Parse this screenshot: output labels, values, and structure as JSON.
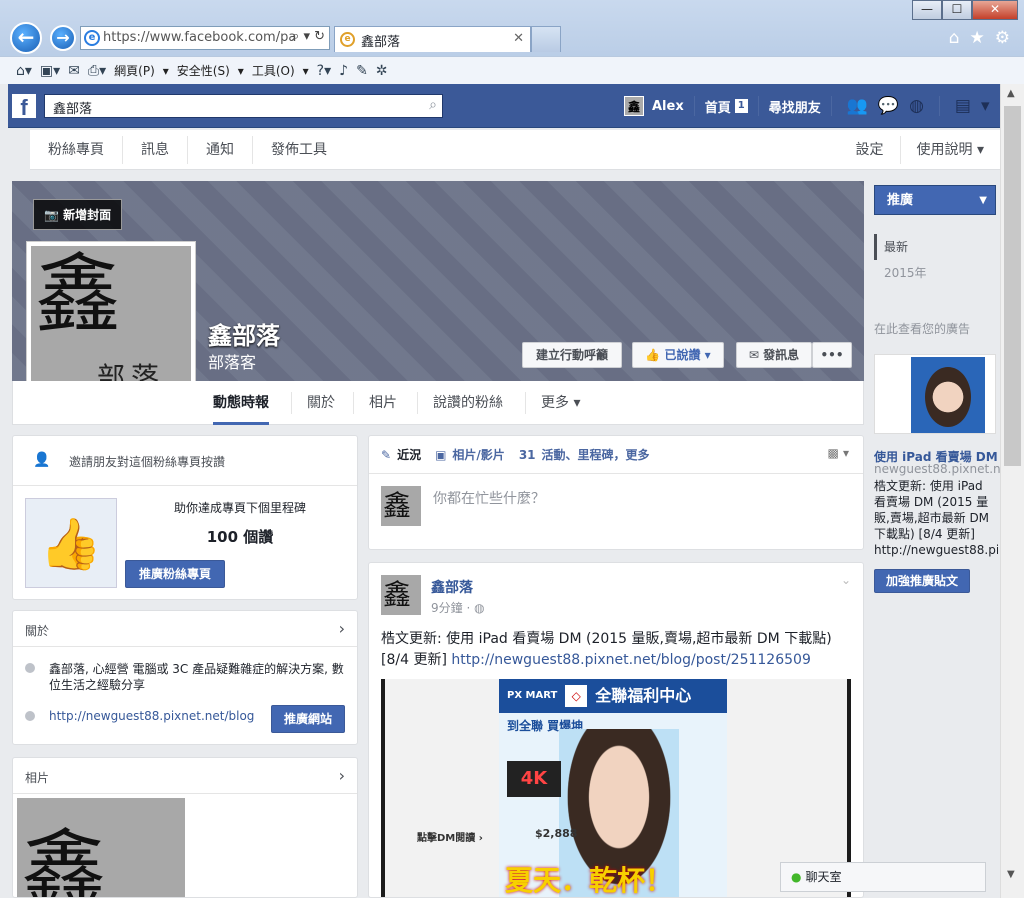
{
  "browser": {
    "address": "https://www.facebook.com/pa",
    "tab_title": "鑫部落",
    "menu_page": "網頁(P)",
    "menu_safety": "安全性(S)",
    "menu_tools": "工具(O)"
  },
  "fb": {
    "search_value": "鑫部落",
    "user": "Alex",
    "home": "首頁",
    "home_count": "1",
    "find_friends": "尋找朋友"
  },
  "pagenav": {
    "items": [
      "粉絲專頁",
      "訊息",
      "通知",
      "發佈工具"
    ],
    "settings": "設定",
    "help": "使用說明"
  },
  "cover": {
    "add_cover": "新增封面",
    "page_name": "鑫部落",
    "category": "部落客",
    "cta": "建立行動呼籲",
    "liked": "已說讚",
    "message": "發訊息",
    "more": "•••"
  },
  "tabs": [
    "動態時報",
    "關於",
    "相片",
    "說讚的粉絲",
    "更多"
  ],
  "invite": {
    "text": "邀請朋友對這個粉絲專頁按讚",
    "goal_line": "助你達成專頁下個里程碑",
    "goal_value": "100 個讚",
    "button": "推廣粉絲專頁"
  },
  "about": {
    "title": "關於",
    "description": "鑫部落, 心經營 電腦或 3C 產品疑難雜症的解決方案, 數位生活之經驗分享",
    "url": "http://newguest88.pixnet.net/blog",
    "button": "推廣網站"
  },
  "photos": {
    "title": "相片"
  },
  "composer": {
    "tab_status": "近況",
    "tab_photo": "相片/影片",
    "tab_event": "活動、里程碑，更多",
    "placeholder": "你都在忙些什麼？"
  },
  "post": {
    "author": "鑫部落",
    "time": "9分鐘 · ",
    "text": "梏文更新: 使用 iPad 看賣場 DM (2015 量販,賣場,超市最新 DM 下載點)[8/4 更新] ",
    "link": "http://newguest88.pixnet.net/blog/post/251126509",
    "dm_brand_small": "PX MART",
    "dm_brand": "全聯福利中心",
    "dm_blurb": "到全聯 買爆坤",
    "dm_slogan": "夏天．乾杯！",
    "dm_price": "$2,888",
    "dm_side": "點擊DM閱讀"
  },
  "rail": {
    "promote": "推廣",
    "years": [
      "最新",
      "2015年"
    ],
    "ad_heading": "在此查看您的廣告",
    "ad_title": "使用 iPad 看賣場 DM (2",
    "ad_url": "newguest88.pixnet.net",
    "ad_body": "梏文更新: 使用 iPad 看賣場 DM (2015 量販,賣場,超市最新 DM 下載點) [8/4 更新] http://newguest88.pixnet.net/blog/p...",
    "boost": "加強推廣貼文"
  },
  "chat": {
    "label": "聊天室"
  },
  "colors": {
    "fb_blue": "#3b5998",
    "button_blue": "#4267b2",
    "link": "#365899"
  }
}
